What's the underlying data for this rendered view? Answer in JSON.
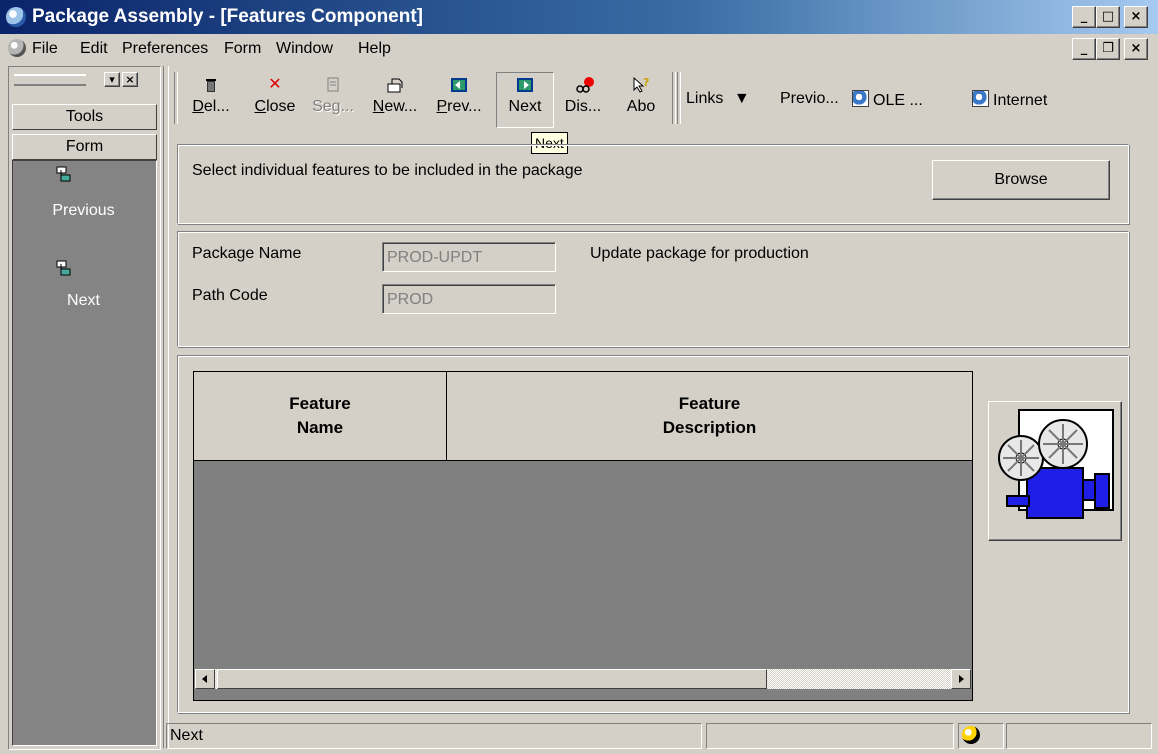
{
  "window": {
    "title": "Package Assembly - [Features Component]",
    "controls": {
      "minimize": "_",
      "maximize": "□",
      "close": "×"
    }
  },
  "menu": {
    "items": [
      "File",
      "Edit",
      "Preferences",
      "Form",
      "Window",
      "Help"
    ],
    "child_controls": {
      "minimize": "_",
      "restore": "❐",
      "close": "×"
    }
  },
  "sidebar": {
    "tabs": [
      "Tools",
      "Form"
    ],
    "actions": [
      {
        "label": "Previous",
        "icon": "form-exit-icon"
      },
      {
        "label": "Next",
        "icon": "form-exit-icon"
      }
    ],
    "panel_controls": {
      "dropdown": "▾",
      "close": "×"
    }
  },
  "toolbar": {
    "buttons": [
      {
        "label": "Del...",
        "icon": "trash-icon",
        "enabled": true
      },
      {
        "label": "Close",
        "icon": "close-x-icon",
        "enabled": true
      },
      {
        "label": "Seg...",
        "icon": "segment-icon",
        "enabled": false
      },
      {
        "label": "New...",
        "icon": "new-folder-icon",
        "enabled": true
      },
      {
        "label": "Prev...",
        "icon": "previous-arrow-icon",
        "enabled": true
      },
      {
        "label": "Next",
        "icon": "next-arrow-icon",
        "enabled": true,
        "pressed": true
      },
      {
        "label": "Dis...",
        "icon": "display-icon",
        "enabled": true
      },
      {
        "label": "Abo",
        "icon": "about-help-icon",
        "enabled": true
      }
    ],
    "links_label": "Links",
    "links": [
      "Previo...",
      "OLE ...",
      "Internet"
    ],
    "tooltip": "Next"
  },
  "instructions": {
    "text": "Select individual features to be included in the package",
    "browse_label": "Browse"
  },
  "header_fields": {
    "package_name_label": "Package Name",
    "package_name_value": "PROD-UPDT",
    "package_description": "Update package for production",
    "path_code_label": "Path Code",
    "path_code_value": "PROD"
  },
  "grid": {
    "columns": [
      "Feature\nName",
      "Feature\nDescription"
    ],
    "rows": []
  },
  "status": {
    "text": "Next"
  },
  "colors": {
    "titlebar_start": "#0a246a",
    "titlebar_end": "#a6caf0",
    "face": "#d4d0c8",
    "grid_background": "#808080"
  }
}
